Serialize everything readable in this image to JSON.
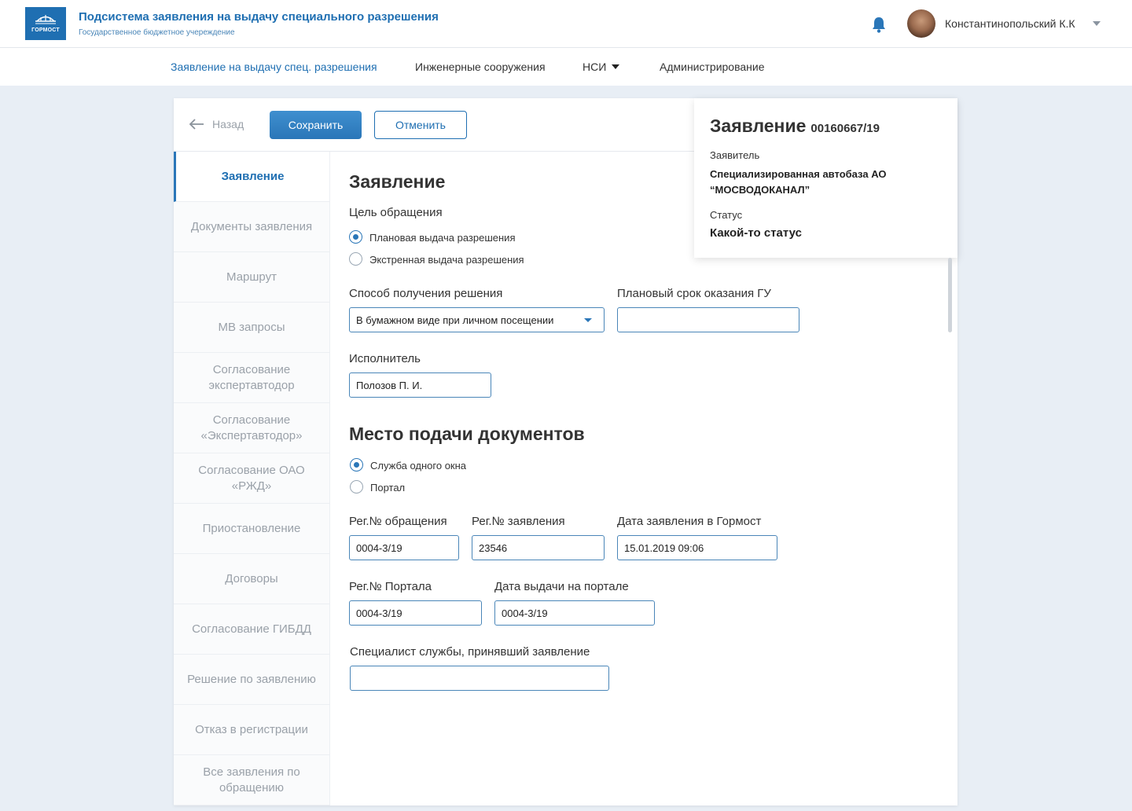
{
  "header": {
    "logo_text": "ГОРМОСТ",
    "title": "Подсистема заявления на выдачу специального разрешения",
    "subtitle": "Государственное бюджетное учереждение",
    "user_name": "Константинопольский К.К"
  },
  "nav": {
    "items": [
      {
        "label": "Заявление на выдачу спец. разрешения",
        "active": true
      },
      {
        "label": "Инженерные сооружения"
      },
      {
        "label": "НСИ",
        "dropdown": true
      },
      {
        "label": "Администрирование"
      }
    ]
  },
  "toolbar": {
    "back_label": "Назад",
    "save_label": "Сохранить",
    "cancel_label": "Отменить"
  },
  "sidebar": {
    "items": [
      {
        "label": "Заявление",
        "active": true
      },
      {
        "label": "Документы заявления"
      },
      {
        "label": "Маршрут"
      },
      {
        "label": "МВ запросы"
      },
      {
        "label": "Согласование экспертавтодор"
      },
      {
        "label": "Согласование «Экспертавтодор»"
      },
      {
        "label": "Согласование ОАО «РЖД»"
      },
      {
        "label": "Приостановление"
      },
      {
        "label": "Договоры"
      },
      {
        "label": "Согласование ГИБДД"
      },
      {
        "label": "Решение по заявлению"
      },
      {
        "label": "Отказ в регистрации"
      },
      {
        "label": "Все заявления по обращению"
      }
    ]
  },
  "form": {
    "section_title": "Заявление",
    "purpose_label": "Цель обращения",
    "purpose_options": [
      "Плановая выдача разрешения",
      "Экстренная выдача разрешения"
    ],
    "purpose_selected": 0,
    "method_label": "Способ получения решения",
    "method_value": "В бумажном виде при личном посещении",
    "deadline_label": "Плановый срок оказания ГУ",
    "deadline_value": "",
    "executor_label": "Исполнитель",
    "executor_value": "Полозов П. И.",
    "place_title": "Место подачи документов",
    "place_options": [
      "Служба одного окна",
      "Портал"
    ],
    "place_selected": 0,
    "reg_appeal_label": "Рег.№ обращения",
    "reg_appeal_value": "0004-3/19",
    "reg_statement_label": "Рег.№ заявления",
    "reg_statement_value": "23546",
    "date_label": "Дата заявления в Гормост",
    "date_value": "15.01.2019 09:06",
    "reg_portal_label": "Рег.№ Портала",
    "reg_portal_value": "0004-3/19",
    "portal_date_label": "Дата выдачи на портале",
    "portal_date_value": "0004-3/19",
    "specialist_label": "Специалист службы, принявший заявление",
    "specialist_value": ""
  },
  "info": {
    "title": "Заявление",
    "number": "00160667/19",
    "applicant_label": "Заявитель",
    "applicant_value": "Специализированная автобаза АО “МОСВОДОКАНАЛ”",
    "status_label": "Статус",
    "status_value": "Какой-то статус"
  },
  "colors": {
    "accent": "#1f6fb2",
    "background": "#e8eef5",
    "sidebar_inactive_text": "#9aa1a9"
  }
}
